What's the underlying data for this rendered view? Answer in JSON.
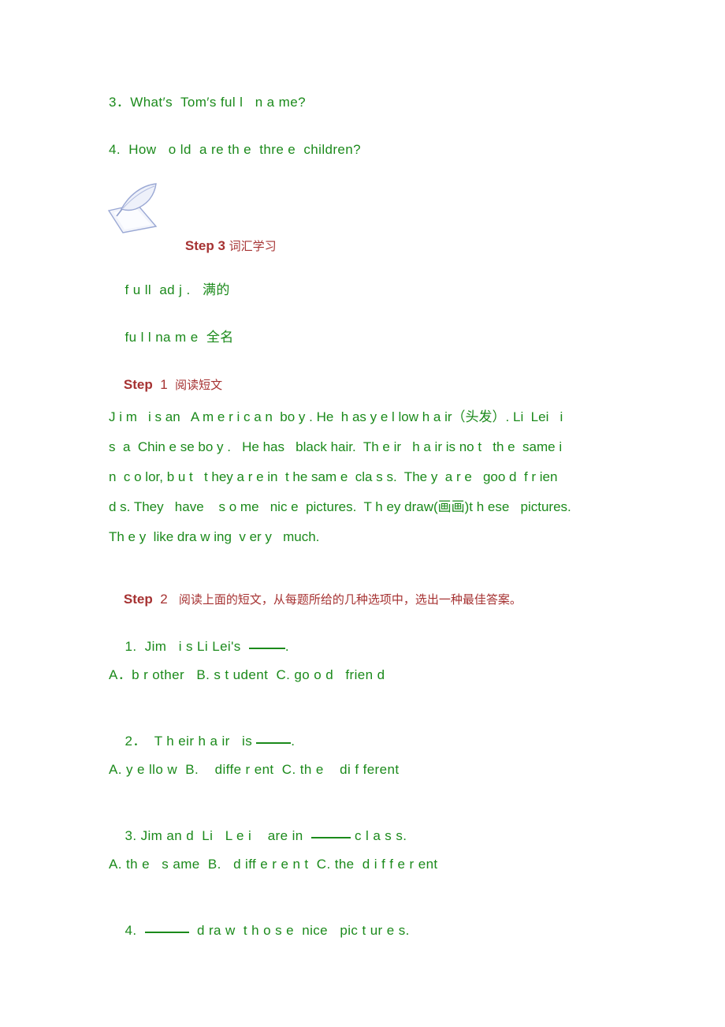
{
  "colors": {
    "body_text": "#1b8a1b",
    "heading_text": "#a63232",
    "page_background": "#ffffff",
    "quill_outline": "#9aa8d4"
  },
  "questions_top": [
    {
      "text": "3．What′s  Tom′s ful l   n a me?"
    },
    {
      "text": "4.  How   o ld  a re th e  thre e  children?"
    }
  ],
  "step3": {
    "label": "Step 3",
    "title_cn": "词汇学习",
    "icon": "quill-pen-writing-icon"
  },
  "vocabulary": [
    {
      "word": "f u ll  ad j .",
      "meaning": "满的"
    },
    {
      "word": "fu l l na m e",
      "meaning": "全名"
    }
  ],
  "step1": {
    "label": "Step",
    "number": "1",
    "title_cn": "阅读短文"
  },
  "passage": {
    "lines": [
      "J i m   i s an   A m e r i c a n  bo y . He  h as y e l low h a ir（头发）. Li  Lei   i",
      "s  a  Chin e se bo y .   He has   black hair.  Th e ir   h a ir is no t   th e  same i",
      "n  c o lor, b u t   t hey a r e in  t he sam e  cla s s.  The y  a r e   goo d  f r ien",
      "d s. They   have    s o me   nic e  pictures.  T h ey draw(画画)t h ese   pictures.",
      "Th e y  like dra w ing  v er y   much."
    ]
  },
  "step2": {
    "label": "Step",
    "number": "2",
    "instruction_cn": "阅读上面的短文，从每题所给的几种选项中，选出一种最佳答案。"
  },
  "multiple_choice": [
    {
      "number": "1.",
      "stem_before": "  Jim   i s Li Lei's  ",
      "stem_after": ".",
      "blank": "w1",
      "options": "A．b r other   B. s t udent  C. go o d   frien d"
    },
    {
      "number": "2．",
      "stem_before": "  T h eir h a ir   is ",
      "stem_after": ".",
      "blank": "w2",
      "options": "A. y e llo w  B.    diffe r ent  C. th e    di f ferent"
    },
    {
      "number": "3.",
      "stem_before": " Jim an d  Li   L e i    are in  ",
      "stem_after": " c l a s s.",
      "blank": "w3",
      "options": "A. th e   s ame  B.   d iff e r e n t  C. the  d i f f e r ent"
    },
    {
      "number": "4.",
      "stem_before": "  ",
      "stem_after": "  d ra w  t h o s e  nice   pic t ur e s.",
      "blank": "w4",
      "options": ""
    }
  ]
}
